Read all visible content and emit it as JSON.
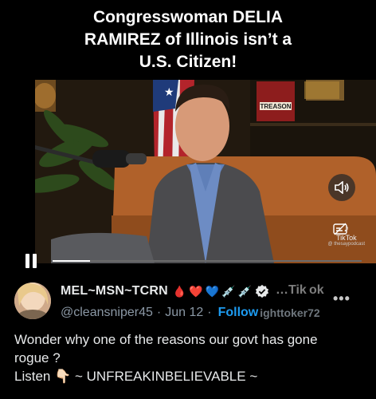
{
  "video": {
    "caption_lines": [
      "Congresswoman DELIA",
      "RAMIREZ of Illinois isn’t a",
      "U.S. Citizen!"
    ],
    "book_title": "TREASON",
    "progress_fraction": 0.12,
    "mute_icon": "speaker-icon",
    "caption_toggle_icon": "captions-off-icon",
    "watermark_label": "TikTok",
    "watermark_handle": "@ thesaypodcast"
  },
  "tweet": {
    "display_name": "MEL~MSN~TCRN",
    "name_emojis": [
      "🩸",
      "❤️",
      "💙",
      "💉",
      "💉"
    ],
    "overlay_ghost": "…Tik ok",
    "handle": "@cleansniper45",
    "separator": "·",
    "date": "Jun 12",
    "separator2": "·",
    "follow_label": "Follow",
    "overlay_ghost2": "ighttoker72",
    "more_label": "•••",
    "body_lines": [
      "Wonder why one of the reasons our govt has gone",
      "rogue ?",
      "Listen 👇🏻 ~ UNFREAKINBELIEVABLE ~"
    ]
  },
  "colors": {
    "background": "#000000",
    "text_primary": "#e7e9ea",
    "text_secondary": "#8b98a5",
    "accent": "#1d9bf0"
  }
}
